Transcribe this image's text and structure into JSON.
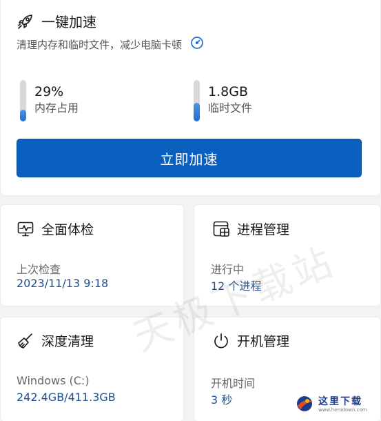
{
  "accelerate": {
    "title": "一键加速",
    "subtitle": "清理内存和临时文件，减少电脑卡顿",
    "memory": {
      "value_text": "29%",
      "label": "内存占用",
      "fill_fraction": 0.29
    },
    "temp_files": {
      "value_text": "1.8GB",
      "label": "临时文件",
      "fill_fraction": 0.45
    },
    "button_label": "立即加速"
  },
  "tiles": {
    "health_check": {
      "title": "全面体检",
      "label": "上次检查",
      "value": "2023/11/13 9:18"
    },
    "processes": {
      "title": "进程管理",
      "label": "进行中",
      "value": "12 个进程"
    },
    "deep_clean": {
      "title": "深度清理",
      "label": "Windows (C:)",
      "value": "242.4GB/411.3GB"
    },
    "startup": {
      "title": "开机管理",
      "label": "开机时间",
      "value": "3 秒"
    }
  },
  "watermark": {
    "text": "天极下载站"
  },
  "corner_logo": {
    "title": "这里下载",
    "subtitle": "www.herodown.com"
  },
  "colors": {
    "accent": "#0a5fbf",
    "value_text": "#1e4f8f",
    "meter_fill": "#1f6fd6",
    "meter_track": "#d8d8d8"
  }
}
